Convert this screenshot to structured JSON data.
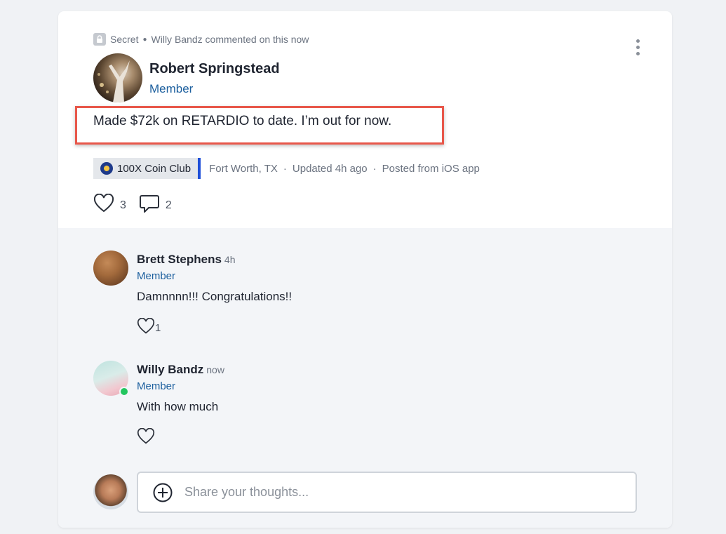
{
  "post": {
    "visibility": "Secret",
    "activity": "Willy Bandz commented on this now",
    "author": {
      "name": "Robert Springstead",
      "role": "Member"
    },
    "text": "Made $72k on RETARDIO to date. I’m out for now.",
    "club": "100X Coin Club",
    "location": "Fort Worth, TX",
    "updated": "Updated 4h ago",
    "source": "Posted from iOS app",
    "likes": "3",
    "comments": "2"
  },
  "comments": [
    {
      "name": "Brett Stephens",
      "time": "4h",
      "role": "Member",
      "text": "Damnnnn!!! Congratulations!!",
      "likes": "1"
    },
    {
      "name": "Willy Bandz",
      "time": "now",
      "role": "Member",
      "text": "With how much",
      "likes": ""
    }
  ],
  "composer": {
    "placeholder": "Share your thoughts..."
  },
  "colors": {
    "role": "#1c5f9e",
    "highlight": "#e8574a",
    "online": "#22c55e",
    "club_accent": "#1d4ed8"
  },
  "icons": [
    "lock-icon",
    "more-options-icon",
    "heart-icon",
    "comment-icon",
    "plus-circle-icon"
  ]
}
